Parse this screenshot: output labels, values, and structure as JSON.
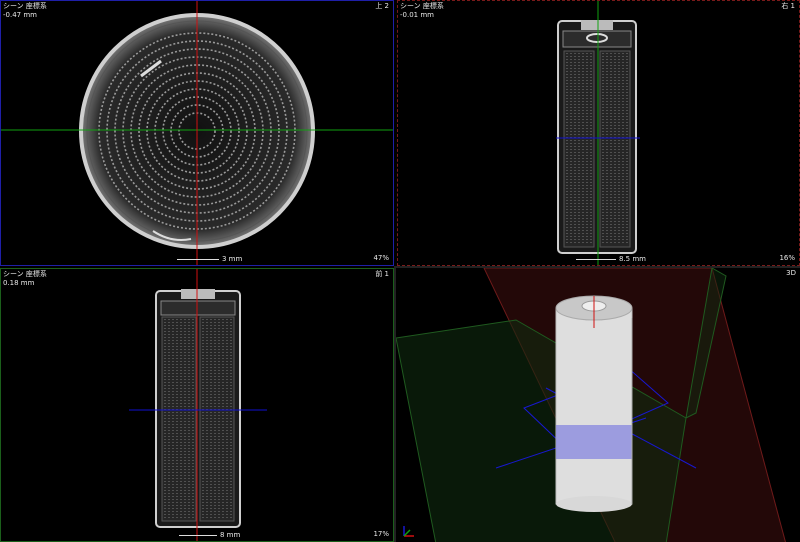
{
  "viewports": {
    "top": {
      "coord_label": "シーン 座標系",
      "offset": "-0.47 mm",
      "orientation": "上 2",
      "scale": "3 mm",
      "zoom": "47%"
    },
    "right": {
      "coord_label": "シーン 座標系",
      "offset": "-0.01 mm",
      "orientation": "右 1",
      "scale": "8.5 mm",
      "zoom": "16%"
    },
    "front": {
      "coord_label": "シーン 座標系",
      "offset": "0.18 mm",
      "orientation": "前 1",
      "scale": "8 mm",
      "zoom": "17%"
    },
    "three_d": {
      "label": "3D"
    }
  },
  "colors": {
    "x_axis": "#d01010",
    "y_axis": "#10a010",
    "z_axis": "#1010d0",
    "plane_red": "#6e1a1a",
    "plane_green": "#1f5a1f"
  },
  "icons": {
    "axis_triad": "xyz-axis-icon"
  }
}
